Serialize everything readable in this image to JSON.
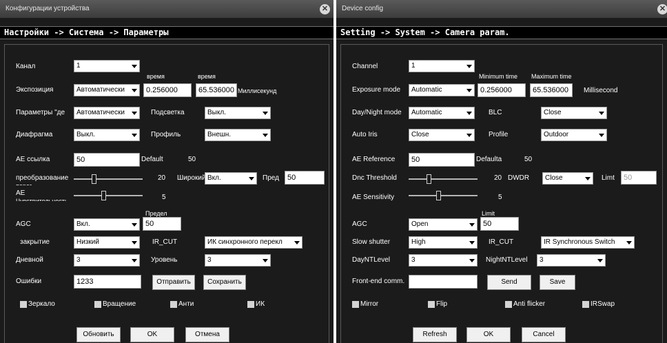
{
  "ru": {
    "window_title": "Конфигурации устройства",
    "close_glyph": "✕",
    "header": "Настройки -> Система -> Параметры",
    "channel_label": "Канал",
    "channel_value": "1",
    "min_time_header": "время",
    "max_time_header": "время",
    "exposure_label": "Экспозиция",
    "exposure_value": "Автоматически",
    "min_time_value": "0.256000",
    "max_time_value": "65.536000",
    "time_unit": "Миллисекунд",
    "daynight_label": "Параметры \"де",
    "daynight_value": "Автоматически",
    "blc_label": "Подсветка",
    "blc_value": "Выкл.",
    "iris_label": "Диафрагма",
    "iris_value": "Выкл.",
    "profile_label": "Профиль",
    "profile_value": "Внешн.",
    "ae_ref_label": "AE ссылка",
    "ae_ref_value": "50",
    "default_label": "Default",
    "default_value": "50",
    "dnc_label": "преобразование",
    "dnc_label_2": "порог",
    "dnc_value": "20",
    "dwdr_label": "Широкий",
    "dwdr_value": "Вкл.",
    "limit_label": "Пред",
    "limit_value": "50",
    "ae_sens_label": "AE",
    "ae_sens_label_2": "Чувствительность",
    "ae_sens_value": "5",
    "agc_label": "AGC",
    "agc_value": "Вкл.",
    "agc_limit_label": "Предел",
    "agc_limit_value": "50",
    "slow_shutter_label": "закрытие",
    "slow_shutter_value": "Низкий",
    "ircut_label": "IR_CUT",
    "ircut_value": "ИК синхронного перекл",
    "daynt_label": "Дневной",
    "daynt_value": "3",
    "nightnt_label": "Уровень",
    "nightnt_value": "3",
    "frontend_label": "Ошибки",
    "frontend_value": "1233",
    "send_label": "Отправить",
    "save_label": "Сохранить",
    "mirror_label": "Зеркало",
    "flip_label": "Вращение",
    "antiflicker_label": "Анти",
    "irswap_label": "ИК",
    "refresh_label": "Обновить",
    "ok_label": "OK",
    "cancel_label": "Отмена"
  },
  "en": {
    "window_title": "Device config",
    "close_glyph": "✕",
    "header": "Setting -> System -> Camera param.",
    "channel_label": "Channel",
    "channel_value": "1",
    "min_time_header": "Minimum time",
    "max_time_header": "Maximum time",
    "exposure_label": "Exposure mode",
    "exposure_value": "Automatic",
    "min_time_value": "0.256000",
    "max_time_value": "65.536000",
    "time_unit": "Millisecond",
    "daynight_label": "Day/Night mode",
    "daynight_value": "Automatic",
    "blc_label": "BLC",
    "blc_value": "Close",
    "iris_label": "Auto Iris",
    "iris_value": "Close",
    "profile_label": "Profile",
    "profile_value": "Outdoor",
    "ae_ref_label": "AE Reference",
    "ae_ref_value": "50",
    "default_label": "Defaulta",
    "default_value": "50",
    "dnc_label": "Dnc Threshold",
    "dnc_value": "20",
    "dwdr_label": "DWDR",
    "dwdr_value": "Close",
    "limit_label": "Limt",
    "limit_value": "50",
    "ae_sens_label": "AE Sensitivity",
    "ae_sens_value": "5",
    "agc_label": "AGC",
    "agc_value": "Open",
    "agc_limit_label": "Limit",
    "agc_limit_value": "50",
    "slow_shutter_label": "Slow shutter",
    "slow_shutter_value": "High",
    "ircut_label": "IR_CUT",
    "ircut_value": "IR Synchronous Switch",
    "daynt_label": "DayNTLevel",
    "daynt_value": "3",
    "nightnt_label": "NightNTLevel",
    "nightnt_value": "3",
    "frontend_label": "Front-end comm.",
    "frontend_value": "",
    "send_label": "Send",
    "save_label": "Save",
    "mirror_label": "Mirror",
    "flip_label": "Flip",
    "antiflicker_label": "Anti flicker",
    "irswap_label": "IRSwap",
    "refresh_label": "Refresh",
    "ok_label": "OK",
    "cancel_label": "Cancel"
  }
}
